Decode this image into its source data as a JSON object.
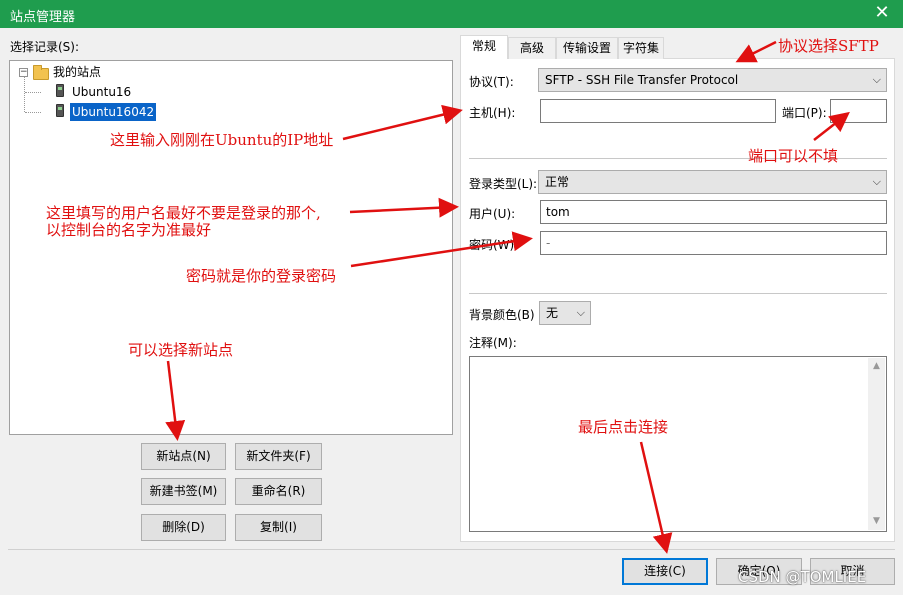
{
  "window": {
    "title": "站点管理器",
    "close_glyph": "✕"
  },
  "left": {
    "select_label": "选择记录(S):",
    "tree": {
      "root": {
        "label": "我的站点",
        "expander": "−"
      },
      "items": [
        {
          "label": "Ubuntu16"
        },
        {
          "label": "Ubuntu16042",
          "selected": true
        }
      ]
    },
    "buttons": {
      "new_site": "新站点(N)",
      "new_folder": "新文件夹(F)",
      "new_bookmark": "新建书签(M)",
      "rename": "重命名(R)",
      "delete": "删除(D)",
      "copy": "复制(I)"
    }
  },
  "tabs": [
    "常规",
    "高级",
    "传输设置",
    "字符集"
  ],
  "general": {
    "protocol_label": "协议(T):",
    "protocol_value": "SFTP - SSH File Transfer Protocol",
    "host_label": "主机(H):",
    "host_value": "",
    "port_label": "端口(P):",
    "port_value": "",
    "logon_type_label": "登录类型(L):",
    "logon_type_value": "正常",
    "user_label": "用户(U):",
    "user_value": "tom",
    "password_label": "密码(W):",
    "password_value": "-",
    "bg_color_label": "背景颜色(B)",
    "bg_color_value": "无",
    "comments_label": "注释(M):"
  },
  "footer": {
    "connect": "连接(C)",
    "ok": "确定(O)",
    "cancel": "取消"
  },
  "annotations": {
    "protocol": "协议选择SFTP",
    "host": "这里输入刚刚在Ubuntu的IP地址",
    "port": "端口可以不填",
    "user_line1": "这里填写的用户名最好不要是登录的那个,",
    "user_line2": "以控制台的名字为准最好",
    "password": "密码就是你的登录密码",
    "new_site": "可以选择新站点",
    "connect": "最后点击连接"
  },
  "watermark": "CSDN @TOMLIEE",
  "colors": {
    "titlebar": "#1f9d4e",
    "annotation": "#e01010",
    "selection": "#0a64c8"
  }
}
